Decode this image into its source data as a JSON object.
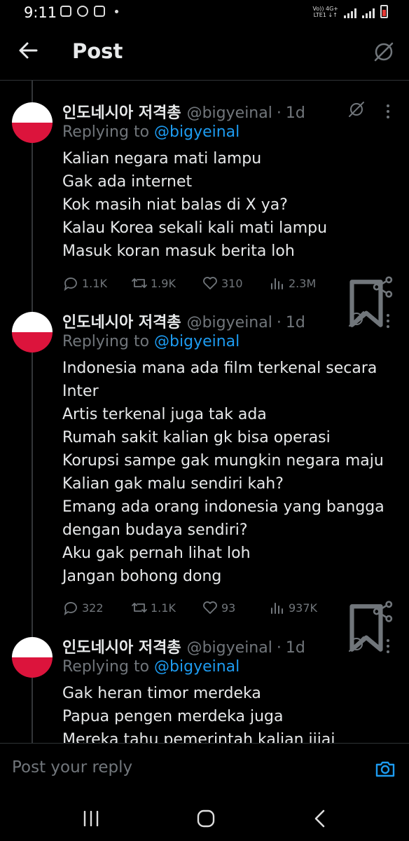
{
  "status_bar": {
    "time": "9:11",
    "network_line1": "Vo))  4G+",
    "network_line2": "LTE1 ↓↑"
  },
  "header": {
    "title": "Post",
    "back_icon": "back-arrow-icon",
    "grok_icon": "grok-icon"
  },
  "tweets": [
    {
      "display_name": "인도네시아 저격총",
      "handle": "@bigyeinal",
      "separator": "·",
      "time": "1d",
      "replying_prefix": "Replying to",
      "replying_to": "@bigyeinal",
      "lines": [
        "Kalian negara mati lampu",
        "Gak ada internet",
        "Kok masih niat balas di X ya?",
        "Kalau Korea sekali kali mati lampu",
        "Masuk koran masuk berita loh"
      ],
      "replies": "1.1K",
      "reposts": "1.9K",
      "likes": "310",
      "views": "2.3M"
    },
    {
      "display_name": "인도네시아 저격총",
      "handle": "@bigyeinal",
      "separator": "·",
      "time": "1d",
      "replying_prefix": "Replying to",
      "replying_to": "@bigyeinal",
      "lines": [
        "Indonesia mana ada film terkenal secara",
        "Inter",
        "Artis terkenal juga tak ada",
        "Rumah sakit kalian gk bisa operasi",
        "Korupsi sampe gak mungkin negara maju",
        "Kalian gak malu sendiri kah?",
        "Emang ada orang indonesia yang bangga",
        "dengan budaya sendiri?",
        "Aku gak pernah lihat loh",
        "Jangan bohong dong"
      ],
      "replies": "322",
      "reposts": "1.1K",
      "likes": "93",
      "views": "937K"
    },
    {
      "display_name": "인도네시아 저격총",
      "handle": "@bigyeinal",
      "separator": "·",
      "time": "1d",
      "replying_prefix": "Replying to",
      "replying_to": "@bigyeinal",
      "lines": [
        "Gak heran timor merdeka",
        "Papua pengen merdeka juga",
        "Mereka tahu pemerintah kalian jijai"
      ]
    }
  ],
  "reply_bar": {
    "placeholder": "Post your reply",
    "camera_icon": "camera-icon"
  },
  "colors": {
    "background": "#000000",
    "text": "#e7e9ea",
    "muted": "#71767b",
    "link": "#1d9bf0",
    "flag_red": "#dc143c",
    "flag_white": "#ffffff"
  }
}
